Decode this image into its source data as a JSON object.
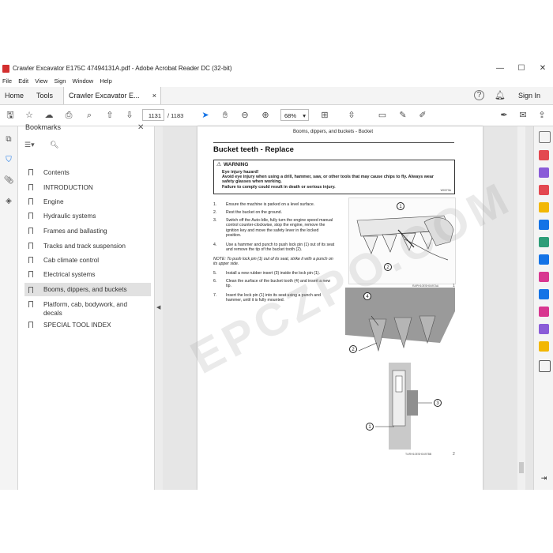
{
  "window": {
    "title": "Crawler Excavator E175C 47494131A.pdf - Adobe Acrobat Reader DC (32-bit)",
    "controls": {
      "minimize": "—",
      "maximize": "☐",
      "close": "✕"
    }
  },
  "menu": [
    "File",
    "Edit",
    "View",
    "Sign",
    "Window",
    "Help"
  ],
  "tabs": {
    "home": "Home",
    "tools": "Tools",
    "doc": "Crawler Excavator E...",
    "doc_close": "×",
    "signin": "Sign In"
  },
  "toolbar": {
    "page_current": "1131",
    "page_total": "/ 1183",
    "zoom": "68%"
  },
  "bookmarks": {
    "title": "Bookmarks",
    "items": [
      "Contents",
      "INTRODUCTION",
      "Engine",
      "Hydraulic systems",
      "Frames and ballasting",
      "Tracks and track suspension",
      "Cab climate control",
      "Electrical systems",
      "Booms, dippers, and buckets",
      "Platform, cab, bodywork, and decals",
      "SPECIAL TOOL INDEX"
    ],
    "active_index": 8
  },
  "document": {
    "running_head": "Booms, dippers, and buckets - Bucket",
    "heading": "Bucket teeth - Replace",
    "warning": {
      "label": "WARNING",
      "text": "Eye injury hazard!\nAvoid eye injury when using a drill, hammer, saw, or other tools that may cause chips to fly. Always wear safety glasses when working.\nFailure to comply could result in death or serious injury.",
      "code": "W0373A"
    },
    "steps": [
      {
        "n": "1.",
        "t": "Ensure the machine is parked on a level surface."
      },
      {
        "n": "2.",
        "t": "Rest the bucket on the ground."
      },
      {
        "n": "3.",
        "t": "Switch off the Auto-Idle, fully turn the engine speed manual control counter-clockwise, stop the engine, remove the ignition key and move the safety lever in the locked position."
      },
      {
        "n": "4.",
        "t": "Use a hammer and punch to push lock pin (1) out of its seat and remove the tip of the bucket tooth (2)."
      },
      {
        "n": "5.",
        "t": "Install a new rubber insert (3) inside the lock pin (1)."
      },
      {
        "n": "6.",
        "t": "Clean the surface of the bucket tooth (4) and insert a new tip."
      },
      {
        "n": "7.",
        "t": "Insert the lock pin (1) into its seat using a punch and hammer, until it is fully mounted."
      }
    ],
    "note": "NOTE: To push lock pin (1) out of its seat, strike it with a punch on its upper side.",
    "fig1_caption": "RAPH10ESH0497AA",
    "fig1_number": "1",
    "fig2_caption": "TURH10ESH0497BB",
    "fig2_number": "2",
    "callouts_fig1": [
      "1",
      "2"
    ],
    "callouts_fig2": [
      "4",
      "2",
      "3",
      "1"
    ]
  },
  "watermark": "EPCZPO.COM",
  "colors": {
    "accent": "#1473e6",
    "warning_red": "#d32f2f"
  }
}
